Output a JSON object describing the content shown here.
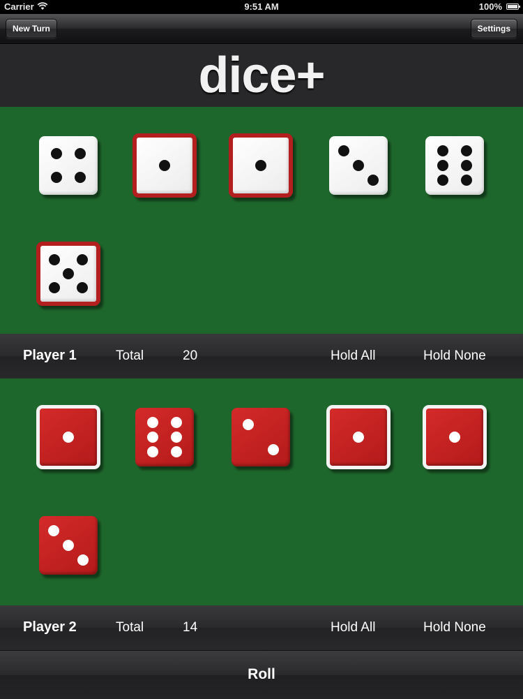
{
  "status": {
    "carrier": "Carrier",
    "time": "9:51 AM",
    "battery": "100%"
  },
  "nav": {
    "new_turn": "New Turn",
    "settings": "Settings"
  },
  "logo": "dice+",
  "players": [
    {
      "name": "Player 1",
      "total_label": "Total",
      "total": "20",
      "hold_all": "Hold All",
      "hold_none": "Hold None",
      "dice_color": "white",
      "dice": [
        {
          "value": 4,
          "held": false
        },
        {
          "value": 1,
          "held": true
        },
        {
          "value": 1,
          "held": true
        },
        {
          "value": 3,
          "held": false
        },
        {
          "value": 6,
          "held": false
        },
        {
          "value": 5,
          "held": true
        }
      ]
    },
    {
      "name": "Player 2",
      "total_label": "Total",
      "total": "14",
      "hold_all": "Hold All",
      "hold_none": "Hold None",
      "dice_color": "red",
      "dice": [
        {
          "value": 1,
          "held": true
        },
        {
          "value": 6,
          "held": false
        },
        {
          "value": 2,
          "held": false
        },
        {
          "value": 1,
          "held": true
        },
        {
          "value": 1,
          "held": true
        },
        {
          "value": 3,
          "held": false
        }
      ]
    }
  ],
  "roll": "Roll"
}
